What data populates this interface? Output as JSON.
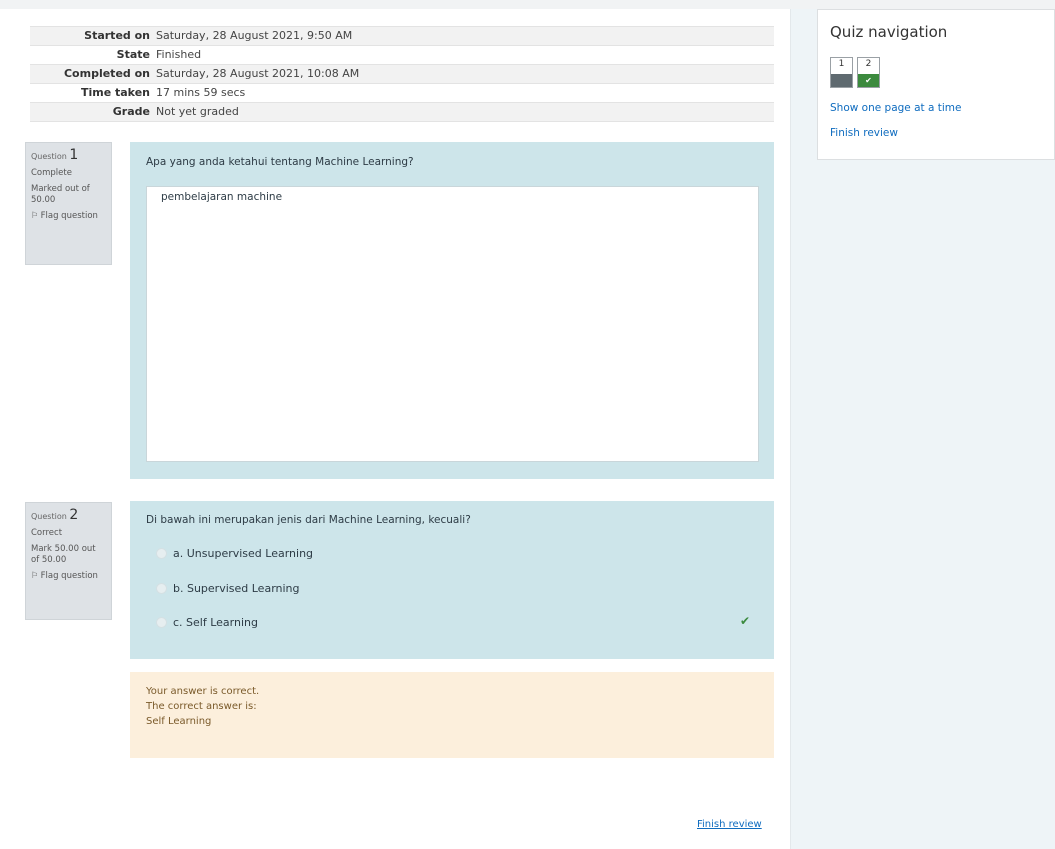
{
  "summary": {
    "rows": [
      {
        "label": "Started on",
        "value": "Saturday, 28 August 2021, 9:50 AM"
      },
      {
        "label": "State",
        "value": "Finished"
      },
      {
        "label": "Completed on",
        "value": "Saturday, 28 August 2021, 10:08 AM"
      },
      {
        "label": "Time taken",
        "value": "17 mins 59 secs"
      },
      {
        "label": "Grade",
        "value": "Not yet graded"
      }
    ]
  },
  "questions": [
    {
      "prefix": "Question",
      "number": "1",
      "state": "Complete",
      "mark": "Marked out of 50.00",
      "flag_label": "Flag question",
      "text": "Apa yang anda ketahui tentang Machine Learning?",
      "answer": "pembelajaran machine"
    },
    {
      "prefix": "Question",
      "number": "2",
      "state": "Correct",
      "mark": "Mark 50.00 out of 50.00",
      "flag_label": "Flag question",
      "text": "Di bawah ini merupakan jenis dari Machine Learning, kecuali?",
      "options": [
        "a. Unsupervised Learning",
        "b. Supervised Learning",
        "c. Self Learning"
      ],
      "selected_option": "c. Self Learning"
    }
  ],
  "feedback": {
    "result": "Your answer is correct.",
    "correct_label": "The correct answer is:",
    "correct_answer": "Self Learning"
  },
  "finish_review_bottom": "Finish review",
  "quiz_nav": {
    "title": "Quiz navigation",
    "buttons": [
      {
        "number": "1",
        "status": "answered"
      },
      {
        "number": "2",
        "status": "correct"
      }
    ],
    "show_one_page": "Show one page at a time",
    "finish_review": "Finish review"
  },
  "colors": {
    "question_bg": "#cde5ea",
    "feedback_bg": "#fcefdc",
    "link": "#0f6cbf",
    "correct": "#3c8a3e"
  },
  "icons": {
    "flag": "flag-icon",
    "correct": "check-icon"
  }
}
